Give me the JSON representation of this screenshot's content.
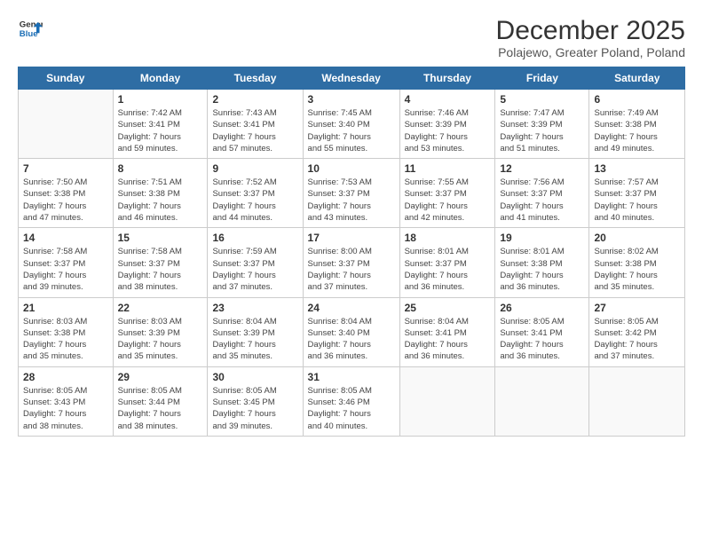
{
  "logo": {
    "line1": "General",
    "line2": "Blue"
  },
  "title": "December 2025",
  "subtitle": "Polajewo, Greater Poland, Poland",
  "days_of_week": [
    "Sunday",
    "Monday",
    "Tuesday",
    "Wednesday",
    "Thursday",
    "Friday",
    "Saturday"
  ],
  "weeks": [
    [
      {
        "day": "",
        "info": ""
      },
      {
        "day": "1",
        "info": "Sunrise: 7:42 AM\nSunset: 3:41 PM\nDaylight: 7 hours\nand 59 minutes."
      },
      {
        "day": "2",
        "info": "Sunrise: 7:43 AM\nSunset: 3:41 PM\nDaylight: 7 hours\nand 57 minutes."
      },
      {
        "day": "3",
        "info": "Sunrise: 7:45 AM\nSunset: 3:40 PM\nDaylight: 7 hours\nand 55 minutes."
      },
      {
        "day": "4",
        "info": "Sunrise: 7:46 AM\nSunset: 3:39 PM\nDaylight: 7 hours\nand 53 minutes."
      },
      {
        "day": "5",
        "info": "Sunrise: 7:47 AM\nSunset: 3:39 PM\nDaylight: 7 hours\nand 51 minutes."
      },
      {
        "day": "6",
        "info": "Sunrise: 7:49 AM\nSunset: 3:38 PM\nDaylight: 7 hours\nand 49 minutes."
      }
    ],
    [
      {
        "day": "7",
        "info": "Sunrise: 7:50 AM\nSunset: 3:38 PM\nDaylight: 7 hours\nand 47 minutes."
      },
      {
        "day": "8",
        "info": "Sunrise: 7:51 AM\nSunset: 3:38 PM\nDaylight: 7 hours\nand 46 minutes."
      },
      {
        "day": "9",
        "info": "Sunrise: 7:52 AM\nSunset: 3:37 PM\nDaylight: 7 hours\nand 44 minutes."
      },
      {
        "day": "10",
        "info": "Sunrise: 7:53 AM\nSunset: 3:37 PM\nDaylight: 7 hours\nand 43 minutes."
      },
      {
        "day": "11",
        "info": "Sunrise: 7:55 AM\nSunset: 3:37 PM\nDaylight: 7 hours\nand 42 minutes."
      },
      {
        "day": "12",
        "info": "Sunrise: 7:56 AM\nSunset: 3:37 PM\nDaylight: 7 hours\nand 41 minutes."
      },
      {
        "day": "13",
        "info": "Sunrise: 7:57 AM\nSunset: 3:37 PM\nDaylight: 7 hours\nand 40 minutes."
      }
    ],
    [
      {
        "day": "14",
        "info": "Sunrise: 7:58 AM\nSunset: 3:37 PM\nDaylight: 7 hours\nand 39 minutes."
      },
      {
        "day": "15",
        "info": "Sunrise: 7:58 AM\nSunset: 3:37 PM\nDaylight: 7 hours\nand 38 minutes."
      },
      {
        "day": "16",
        "info": "Sunrise: 7:59 AM\nSunset: 3:37 PM\nDaylight: 7 hours\nand 37 minutes."
      },
      {
        "day": "17",
        "info": "Sunrise: 8:00 AM\nSunset: 3:37 PM\nDaylight: 7 hours\nand 37 minutes."
      },
      {
        "day": "18",
        "info": "Sunrise: 8:01 AM\nSunset: 3:37 PM\nDaylight: 7 hours\nand 36 minutes."
      },
      {
        "day": "19",
        "info": "Sunrise: 8:01 AM\nSunset: 3:38 PM\nDaylight: 7 hours\nand 36 minutes."
      },
      {
        "day": "20",
        "info": "Sunrise: 8:02 AM\nSunset: 3:38 PM\nDaylight: 7 hours\nand 35 minutes."
      }
    ],
    [
      {
        "day": "21",
        "info": "Sunrise: 8:03 AM\nSunset: 3:38 PM\nDaylight: 7 hours\nand 35 minutes."
      },
      {
        "day": "22",
        "info": "Sunrise: 8:03 AM\nSunset: 3:39 PM\nDaylight: 7 hours\nand 35 minutes."
      },
      {
        "day": "23",
        "info": "Sunrise: 8:04 AM\nSunset: 3:39 PM\nDaylight: 7 hours\nand 35 minutes."
      },
      {
        "day": "24",
        "info": "Sunrise: 8:04 AM\nSunset: 3:40 PM\nDaylight: 7 hours\nand 36 minutes."
      },
      {
        "day": "25",
        "info": "Sunrise: 8:04 AM\nSunset: 3:41 PM\nDaylight: 7 hours\nand 36 minutes."
      },
      {
        "day": "26",
        "info": "Sunrise: 8:05 AM\nSunset: 3:41 PM\nDaylight: 7 hours\nand 36 minutes."
      },
      {
        "day": "27",
        "info": "Sunrise: 8:05 AM\nSunset: 3:42 PM\nDaylight: 7 hours\nand 37 minutes."
      }
    ],
    [
      {
        "day": "28",
        "info": "Sunrise: 8:05 AM\nSunset: 3:43 PM\nDaylight: 7 hours\nand 38 minutes."
      },
      {
        "day": "29",
        "info": "Sunrise: 8:05 AM\nSunset: 3:44 PM\nDaylight: 7 hours\nand 38 minutes."
      },
      {
        "day": "30",
        "info": "Sunrise: 8:05 AM\nSunset: 3:45 PM\nDaylight: 7 hours\nand 39 minutes."
      },
      {
        "day": "31",
        "info": "Sunrise: 8:05 AM\nSunset: 3:46 PM\nDaylight: 7 hours\nand 40 minutes."
      },
      {
        "day": "",
        "info": ""
      },
      {
        "day": "",
        "info": ""
      },
      {
        "day": "",
        "info": ""
      }
    ]
  ]
}
